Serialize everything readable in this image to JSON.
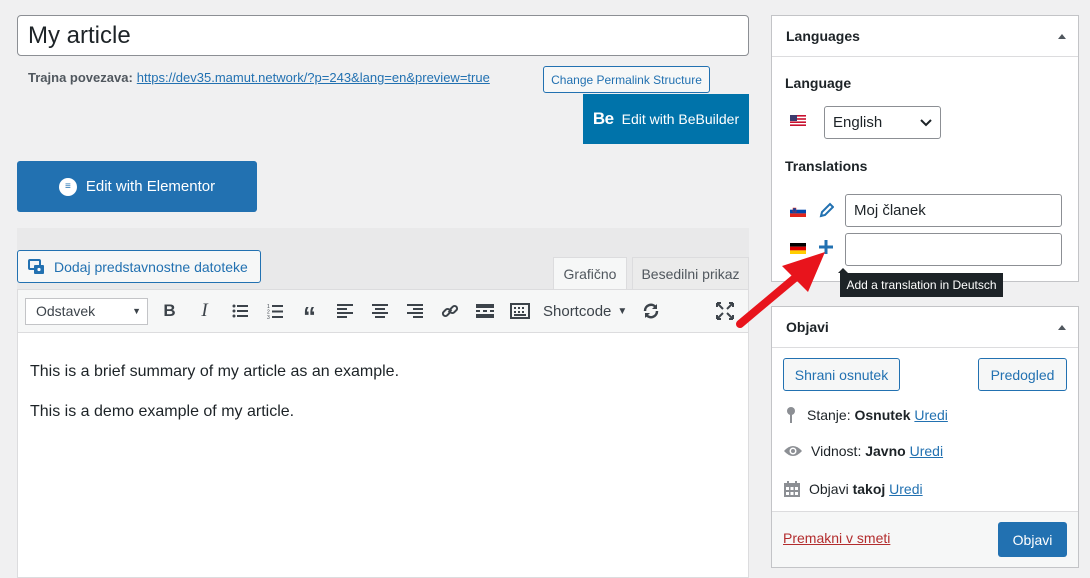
{
  "title": {
    "value": "My article"
  },
  "permalink": {
    "label": "Trajna povezava:",
    "url": "https://dev35.mamut.network/?p=243&lang=en&preview=true",
    "change_button": "Change Permalink Structure"
  },
  "builders": {
    "bebuilder_logo": "Be",
    "bebuilder_label": "Edit with BeBuilder",
    "elementor_label": "Edit with Elementor"
  },
  "editor": {
    "add_media": "Dodaj predstavnostne datoteke",
    "tabs": {
      "visual": "Grafično",
      "text": "Besedilni prikaz"
    },
    "format_select": "Odstavek",
    "shortcode": "Shortcode",
    "paragraphs": [
      "This is a brief summary of my article as an example.",
      "This is a demo example of my article."
    ]
  },
  "languages_panel": {
    "title": "Languages",
    "language_label": "Language",
    "selected_language": "English",
    "translations_label": "Translations",
    "translations": [
      {
        "flag": "slovenian-flag-icon",
        "action": "edit-pencil-icon",
        "value": "Moj članek"
      },
      {
        "flag": "german-flag-icon",
        "action": "add-plus-icon",
        "value": ""
      }
    ],
    "tooltip": "Add a translation in Deutsch"
  },
  "publish_panel": {
    "title": "Objavi",
    "save_draft": "Shrani osnutek",
    "preview": "Predogled",
    "status_label": "Stanje:",
    "status_value": "Osnutek",
    "visibility_label": "Vidnost:",
    "visibility_value": "Javno",
    "schedule_label": "Objavi",
    "schedule_value": "takoj",
    "edit_link": "Uredi",
    "trash": "Premakni v smeti",
    "publish": "Objavi"
  },
  "colors": {
    "accent": "#2271b1",
    "annotation_arrow": "#e8141c"
  }
}
